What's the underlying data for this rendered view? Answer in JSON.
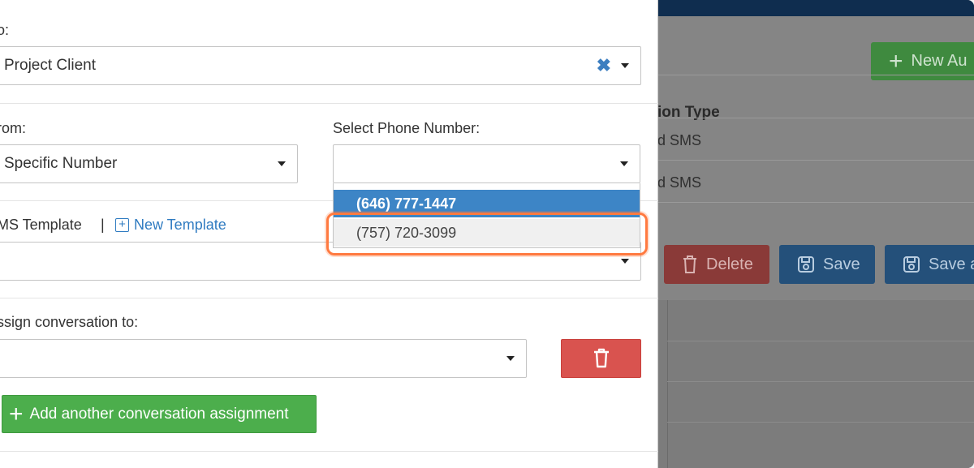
{
  "background_app": {
    "new_button_label": "New Au",
    "table": {
      "header": "ion Type",
      "rows": [
        "d SMS",
        "d SMS"
      ]
    },
    "buttons": {
      "delete": "Delete",
      "save": "Save",
      "save_and": "Save a"
    }
  },
  "form": {
    "send_to": {
      "label": "o:",
      "value": "Project Client"
    },
    "send_from": {
      "label": "rom:",
      "value": "Specific Number"
    },
    "phone_number": {
      "label": "Select Phone Number:",
      "value": "",
      "options": [
        "(646) 777-1447",
        "(757) 720-3099"
      ],
      "selected_index": 0,
      "hover_index": 1
    },
    "sms_template": {
      "label": "MS Template",
      "separator": "|",
      "new_template_label": "New Template",
      "value": ""
    },
    "assign": {
      "label": "ssign conversation to:",
      "value": ""
    },
    "add_assignment_label": "Add another conversation assignment"
  },
  "colors": {
    "accent_blue": "#3d85c6",
    "danger_red": "#d9534f",
    "success_green": "#4cae4c",
    "highlight_orange": "#ff7a40"
  }
}
